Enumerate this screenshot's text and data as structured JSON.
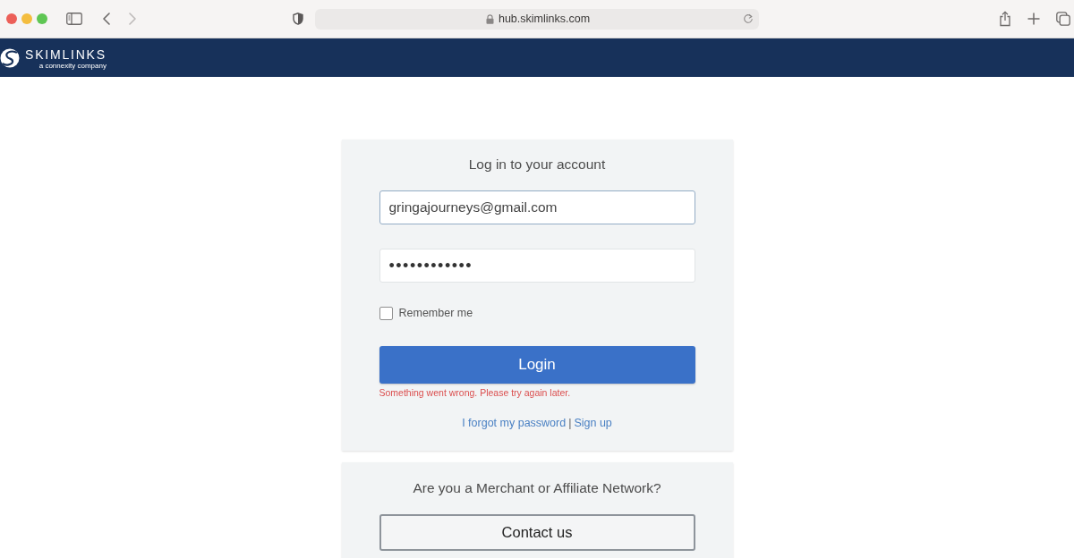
{
  "browser": {
    "url": "hub.skimlinks.com",
    "back": {
      "disabled": false
    },
    "forward": {
      "disabled": true
    }
  },
  "header": {
    "brand": "SKIMLINKS",
    "tagline": "a connexity company"
  },
  "login_card": {
    "title": "Log in to your account",
    "email_field": {
      "value": "gringajourneys@gmail.com"
    },
    "password_field": {
      "value": "••••••••••••"
    },
    "remember_me": {
      "label": "Remember me",
      "checked": false
    },
    "login_button": "Login",
    "error": "Something went wrong. Please try again later.",
    "links": [
      {
        "kind": "link",
        "label": "I forgot my password"
      },
      {
        "kind": "separator",
        "label": "|"
      },
      {
        "kind": "link",
        "label": "Sign up"
      }
    ]
  },
  "merchant_card": {
    "title": "Are you a Merchant or Affiliate Network?",
    "contact_button": "Contact us"
  }
}
